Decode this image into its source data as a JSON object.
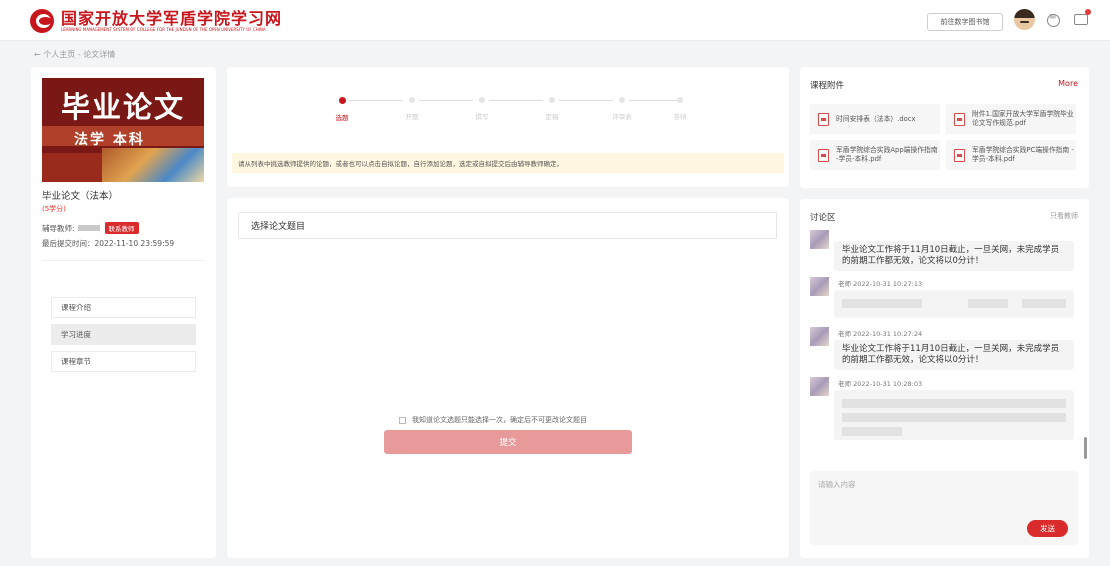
{
  "header": {
    "logo_cn": "国家开放大学军盾学院学习网",
    "logo_en": "LEARNING MANAGEMENT SYSTEM OF COLLEGE FOR THE JUNDUN OF THE OPEN UNIVERSITY OF CHINA",
    "library_button": "前往数字图书馆"
  },
  "breadcrumb": "← 个人主页 - 论文详情",
  "course": {
    "cover_title": "毕业论文",
    "cover_subtitle": "法学 本科",
    "name": "毕业论文（法本）",
    "credits": "(5学分)",
    "tutor_label": "辅导教师:",
    "contact_button": "联系教师",
    "deadline": "最后提交时间：2022-11-10 23:59:59"
  },
  "menu": [
    {
      "label": "课程介绍",
      "active": false
    },
    {
      "label": "学习进度",
      "active": true
    },
    {
      "label": "课程章节",
      "active": false
    }
  ],
  "steps": [
    {
      "label": "选题",
      "active": true
    },
    {
      "label": "开题",
      "active": false
    },
    {
      "label": "撰写",
      "active": false
    },
    {
      "label": "定稿",
      "active": false
    },
    {
      "label": "评审表",
      "active": false
    },
    {
      "label": "答辩",
      "active": false
    }
  ],
  "notice": "请从列表中挑选教师提供的论题，或者也可以点击自拟论题，自行添加论题，选定或自拟提交后由辅导教师确定。",
  "select": {
    "placeholder": "选择论文题目",
    "agree_text": "我知道论文选题只能选择一次，确定后不可更改论文题目",
    "submit": "提交"
  },
  "attachments": {
    "title": "课程附件",
    "more": "More",
    "files": [
      {
        "name": "时间安排表（法本）.docx"
      },
      {
        "name": "附件1.国家开放大学军盾学院毕业论文写作规范.pdf"
      },
      {
        "name": "军盾学院综合实践App端操作指南 -学员-本科.pdf"
      },
      {
        "name": "军盾学院综合实践PC端操作指南 -学员-本科.pdf"
      }
    ]
  },
  "discussion": {
    "title": "讨论区",
    "only_teacher": "只看教师",
    "messages": [
      {
        "meta": "",
        "text": "毕业论文工作将于11月10日截止，一旦关网，未完成学员的前期工作都无效，论文将以0分计！"
      },
      {
        "meta": "老师 2022-10-31 10:27:13",
        "text": ""
      },
      {
        "meta": "老师 2022-10-31 10:27:24",
        "text": "毕业论文工作将于11月10日截止，一旦关网，未完成学员的前期工作都无效，论文将以0分计！"
      },
      {
        "meta": "老师 2022-10-31 10:28:03",
        "text": ""
      }
    ],
    "input_placeholder": "请输入内容",
    "send": "发送"
  },
  "colors": {
    "brand": "#c8161d",
    "submit_disabled": "#e89a9a",
    "notice_bg": "#fff7e0"
  }
}
